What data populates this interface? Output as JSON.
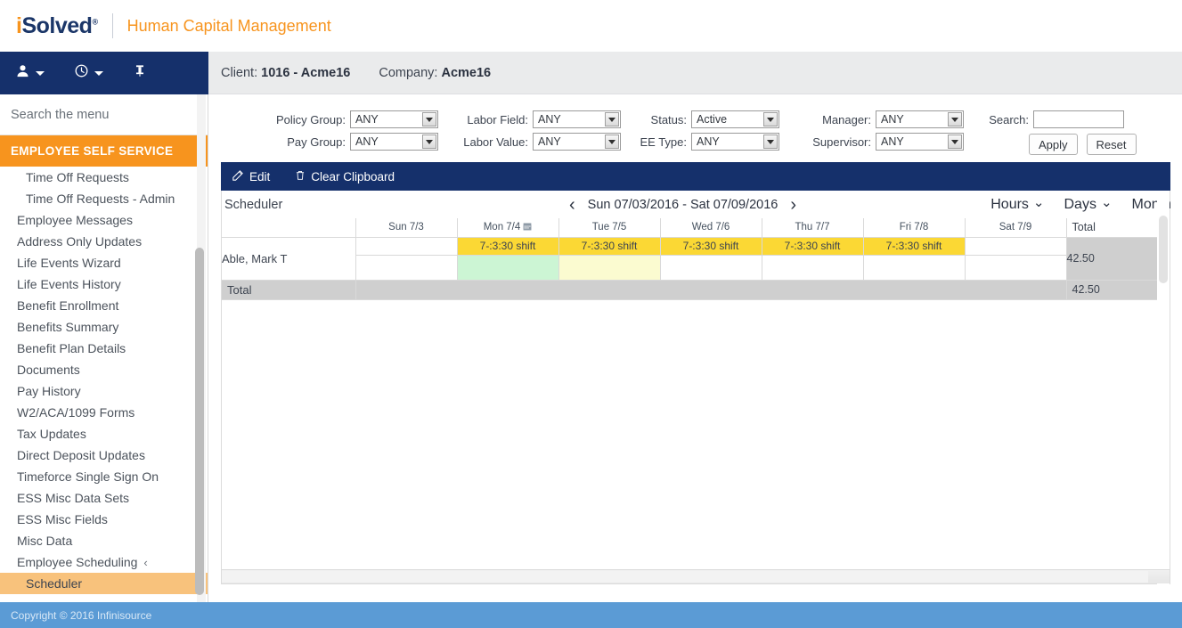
{
  "brand": {
    "logo_i": "i",
    "logo_rest": "Solved",
    "logo_reg": "®",
    "tagline": "Human Capital Management"
  },
  "navstrip": {
    "items": [
      {
        "name": "user-menu",
        "icon": "user-icon",
        "has_caret": true
      },
      {
        "name": "clock-menu",
        "icon": "clock-icon",
        "has_caret": true
      },
      {
        "name": "pin-toggle",
        "icon": "pin-icon",
        "has_caret": false
      }
    ]
  },
  "clientbar": {
    "client_label": "Client:",
    "client_value": "1016 - Acme16",
    "company_label": "Company:",
    "company_value": "Acme16"
  },
  "sidebar": {
    "search_placeholder": "Search the menu",
    "section_header": "EMPLOYEE SELF SERVICE",
    "items": [
      {
        "label": "Time Off Requests",
        "sub": true,
        "active": false
      },
      {
        "label": "Time Off Requests - Admin",
        "sub": true,
        "active": false
      },
      {
        "label": "Employee Messages",
        "sub": false,
        "active": false
      },
      {
        "label": "Address Only Updates",
        "sub": false,
        "active": false
      },
      {
        "label": "Life Events Wizard",
        "sub": false,
        "active": false
      },
      {
        "label": "Life Events History",
        "sub": false,
        "active": false
      },
      {
        "label": "Benefit Enrollment",
        "sub": false,
        "active": false
      },
      {
        "label": "Benefits Summary",
        "sub": false,
        "active": false
      },
      {
        "label": "Benefit Plan Details",
        "sub": false,
        "active": false
      },
      {
        "label": "Documents",
        "sub": false,
        "active": false
      },
      {
        "label": "Pay History",
        "sub": false,
        "active": false
      },
      {
        "label": "W2/ACA/1099 Forms",
        "sub": false,
        "active": false
      },
      {
        "label": "Tax Updates",
        "sub": false,
        "active": false
      },
      {
        "label": "Direct Deposit Updates",
        "sub": false,
        "active": false
      },
      {
        "label": "Timeforce Single Sign On",
        "sub": false,
        "active": false
      },
      {
        "label": "ESS Misc Data Sets",
        "sub": false,
        "active": false
      },
      {
        "label": "ESS Misc Fields",
        "sub": false,
        "active": false
      },
      {
        "label": "Misc Data",
        "sub": false,
        "active": false
      },
      {
        "label": "Employee Scheduling",
        "sub": false,
        "active": false,
        "chevron": "‹"
      },
      {
        "label": "Scheduler",
        "sub": true,
        "active": true
      }
    ]
  },
  "filters": {
    "policy_group": {
      "label": "Policy Group:",
      "value": "ANY"
    },
    "pay_group": {
      "label": "Pay Group:",
      "value": "ANY"
    },
    "labor_field": {
      "label": "Labor Field:",
      "value": "ANY"
    },
    "labor_value": {
      "label": "Labor Value:",
      "value": "ANY"
    },
    "status": {
      "label": "Status:",
      "value": "Active"
    },
    "ee_type": {
      "label": "EE Type:",
      "value": "ANY"
    },
    "manager": {
      "label": "Manager:",
      "value": "ANY"
    },
    "supervisor": {
      "label": "Supervisor:",
      "value": "ANY"
    },
    "search": {
      "label": "Search:",
      "value": "",
      "placeholder": ""
    },
    "apply_label": "Apply",
    "reset_label": "Reset"
  },
  "toolbar": {
    "edit_label": "Edit",
    "clear_clipboard_label": "Clear Clipboard"
  },
  "scheduler": {
    "title": "Scheduler",
    "prev_arrow": "‹",
    "next_arrow": "›",
    "date_range": "Sun 07/03/2016 - Sat 07/09/2016",
    "views": [
      {
        "label": "Hours",
        "has_chevron": true
      },
      {
        "label": "Days",
        "has_chevron": true
      },
      {
        "label": "Month",
        "has_chevron": false
      }
    ],
    "columns": [
      {
        "key": "name",
        "label": ""
      },
      {
        "key": "sun",
        "label": "Sun 7/3",
        "icon": null
      },
      {
        "key": "mon",
        "label": "Mon 7/4",
        "icon": "calendar-icon"
      },
      {
        "key": "tue",
        "label": "Tue 7/5",
        "icon": null
      },
      {
        "key": "wed",
        "label": "Wed 7/6",
        "icon": null
      },
      {
        "key": "thu",
        "label": "Thu 7/7",
        "icon": null
      },
      {
        "key": "fri",
        "label": "Fri 7/8",
        "icon": null
      },
      {
        "key": "sat",
        "label": "Sat 7/9",
        "icon": null
      },
      {
        "key": "total",
        "label": "Total"
      }
    ],
    "rows": [
      {
        "employee": "Able, Mark T",
        "shifts": [
          "",
          "7-:3:30 shift",
          "7-:3:30 shift",
          "7-:3:30 shift",
          "7-:3:30 shift",
          "7-:3:30 shift",
          ""
        ],
        "total": "42.50",
        "clipboard": [
          "none",
          "green",
          "yellow",
          "none",
          "none",
          "none",
          "none"
        ]
      }
    ],
    "total_row": {
      "label": "Total",
      "total": "42.50"
    }
  },
  "footer": {
    "copyright": "Copyright © 2016 Infinisource"
  },
  "colors": {
    "brand_navy": "#15306b",
    "brand_orange": "#f7941e",
    "shift_yellow": "#fbd834",
    "clipboard_green": "#ccf5d4",
    "clipboard_yellow": "#fbfbd0",
    "total_gray": "#cfcfcf",
    "footer_blue": "#5b9bd5",
    "active_menu": "#f8c27c"
  }
}
